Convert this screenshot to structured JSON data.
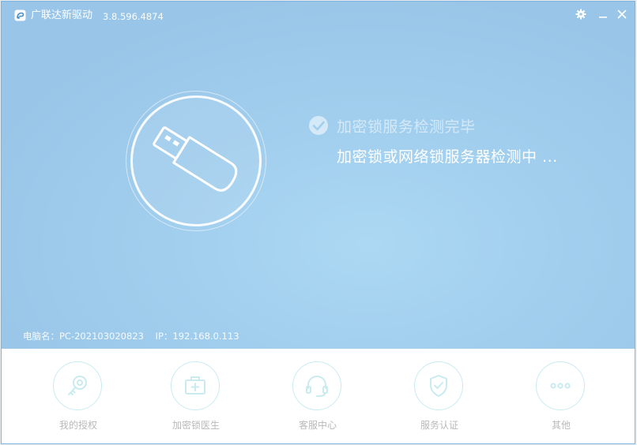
{
  "window": {
    "title": "广联达新驱动",
    "version": "3.8.596.4874"
  },
  "status": {
    "done_text": "加密锁服务检测完毕",
    "current_text": "加密锁或网络锁服务器检测中 ..."
  },
  "info": {
    "computer_label": "电脑名：",
    "computer_name": "PC-202103020823",
    "ip_label": "IP：",
    "ip_value": "192.168.0.113"
  },
  "nav": {
    "items": [
      {
        "label": "我的授权",
        "icon": "key-icon"
      },
      {
        "label": "加密锁医生",
        "icon": "medical-kit-icon"
      },
      {
        "label": "客服中心",
        "icon": "headset-icon"
      },
      {
        "label": "服务认证",
        "icon": "shield-check-icon"
      },
      {
        "label": "其他",
        "icon": "more-icon"
      }
    ]
  },
  "colors": {
    "main_bg": "#a2cfee",
    "nav_icon": "#c9ebf0",
    "nav_label": "#b9b9b9"
  }
}
